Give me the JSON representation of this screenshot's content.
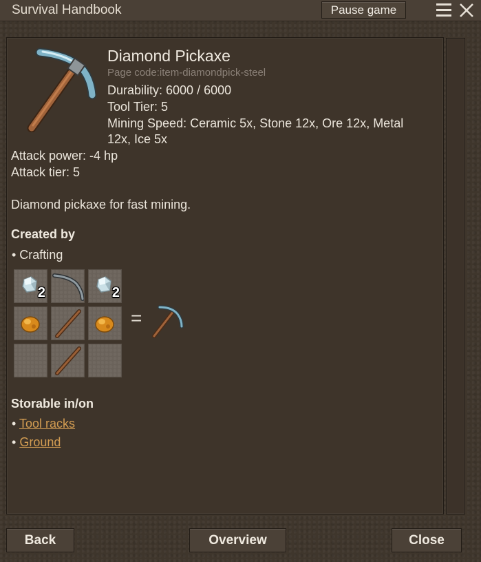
{
  "window": {
    "title": "Survival Handbook",
    "pause_label": "Pause game"
  },
  "item": {
    "name": "Diamond Pickaxe",
    "page_code": "Page code:item-diamondpick-steel",
    "durability": "Durability: 6000 / 6000",
    "tool_tier": "Tool Tier: 5",
    "mining_speed_1": "Mining Speed: Ceramic 5x, Stone 12x, Ore 12x, Metal",
    "mining_speed_2": "12x, Ice 5x",
    "attack_power": "Attack power: -4 hp",
    "attack_tier": "Attack tier: 5",
    "description": "Diamond pickaxe for fast mining."
  },
  "created_by": {
    "heading": "Created by",
    "method": "• Crafting",
    "grid": [
      {
        "icon": "diamond-crystal-icon",
        "qty": "2"
      },
      {
        "icon": "pickaxe-head-icon",
        "qty": ""
      },
      {
        "icon": "diamond-crystal-icon",
        "qty": "2"
      },
      {
        "icon": "resin-icon",
        "qty": ""
      },
      {
        "icon": "stick-icon",
        "qty": ""
      },
      {
        "icon": "resin-icon",
        "qty": ""
      },
      {
        "icon": "empty",
        "qty": ""
      },
      {
        "icon": "stick-icon",
        "qty": ""
      },
      {
        "icon": "empty",
        "qty": ""
      }
    ],
    "equals": "=",
    "result_icon": "diamond-pickaxe-icon"
  },
  "storable": {
    "heading": "Storable in/on",
    "bullet": "•",
    "items": [
      "Tool racks",
      "Ground"
    ]
  },
  "footer": {
    "back": "Back",
    "overview": "Overview",
    "close": "Close"
  }
}
